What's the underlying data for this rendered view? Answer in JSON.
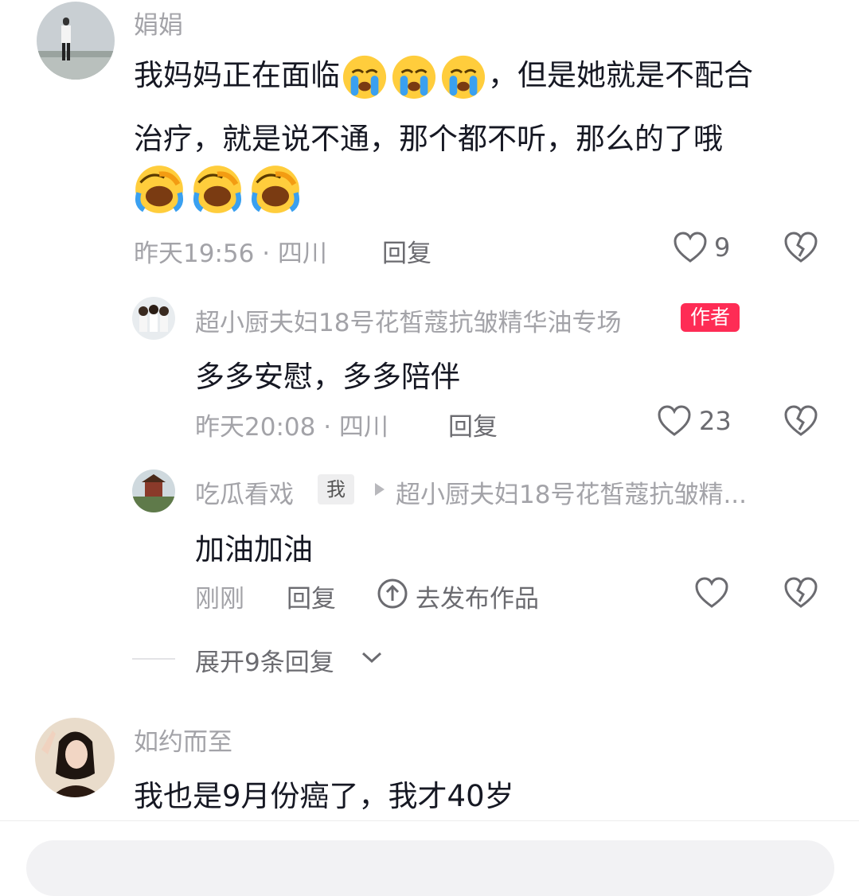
{
  "comments": [
    {
      "author": "娟娟",
      "text_line1_before_emoji": "我妈妈正在面临",
      "text_line1_after_emoji": "，但是她就是不配合",
      "text_line2": "治疗，就是说不通，那个都不听，那么的了哦",
      "meta": "昨天19:56 · 四川",
      "reply_label": "回复",
      "likes": "9",
      "emoji_line1": [
        "crying-face",
        "crying-face",
        "crying-face"
      ],
      "emoji_line3": [
        "laughing-crying-face",
        "laughing-crying-face",
        "laughing-crying-face"
      ]
    },
    {
      "author": "如约而至",
      "text": "我也是9月份癌了，我才40岁"
    }
  ],
  "replies": [
    {
      "author": "超小厨夫妇18号花皙蔻抗皱精华油专场",
      "badge": "作者",
      "text": "多多安慰，多多陪伴",
      "meta": "昨天20:08 · 四川",
      "reply_label": "回复",
      "likes": "23"
    },
    {
      "author": "吃瓜看戏",
      "me_badge": "我",
      "reply_to": "超小厨夫妇18号花皙蔻抗皱精...",
      "text": "加油加油",
      "meta": "刚刚",
      "reply_label": "回复",
      "publish_label": "去发布作品"
    }
  ],
  "expand_label": "展开9条回复",
  "colors": {
    "name_gray": "#a3a3a8",
    "text_dark": "#161823",
    "author_badge": "#fe2c55",
    "icon_gray": "#6b6b70"
  }
}
